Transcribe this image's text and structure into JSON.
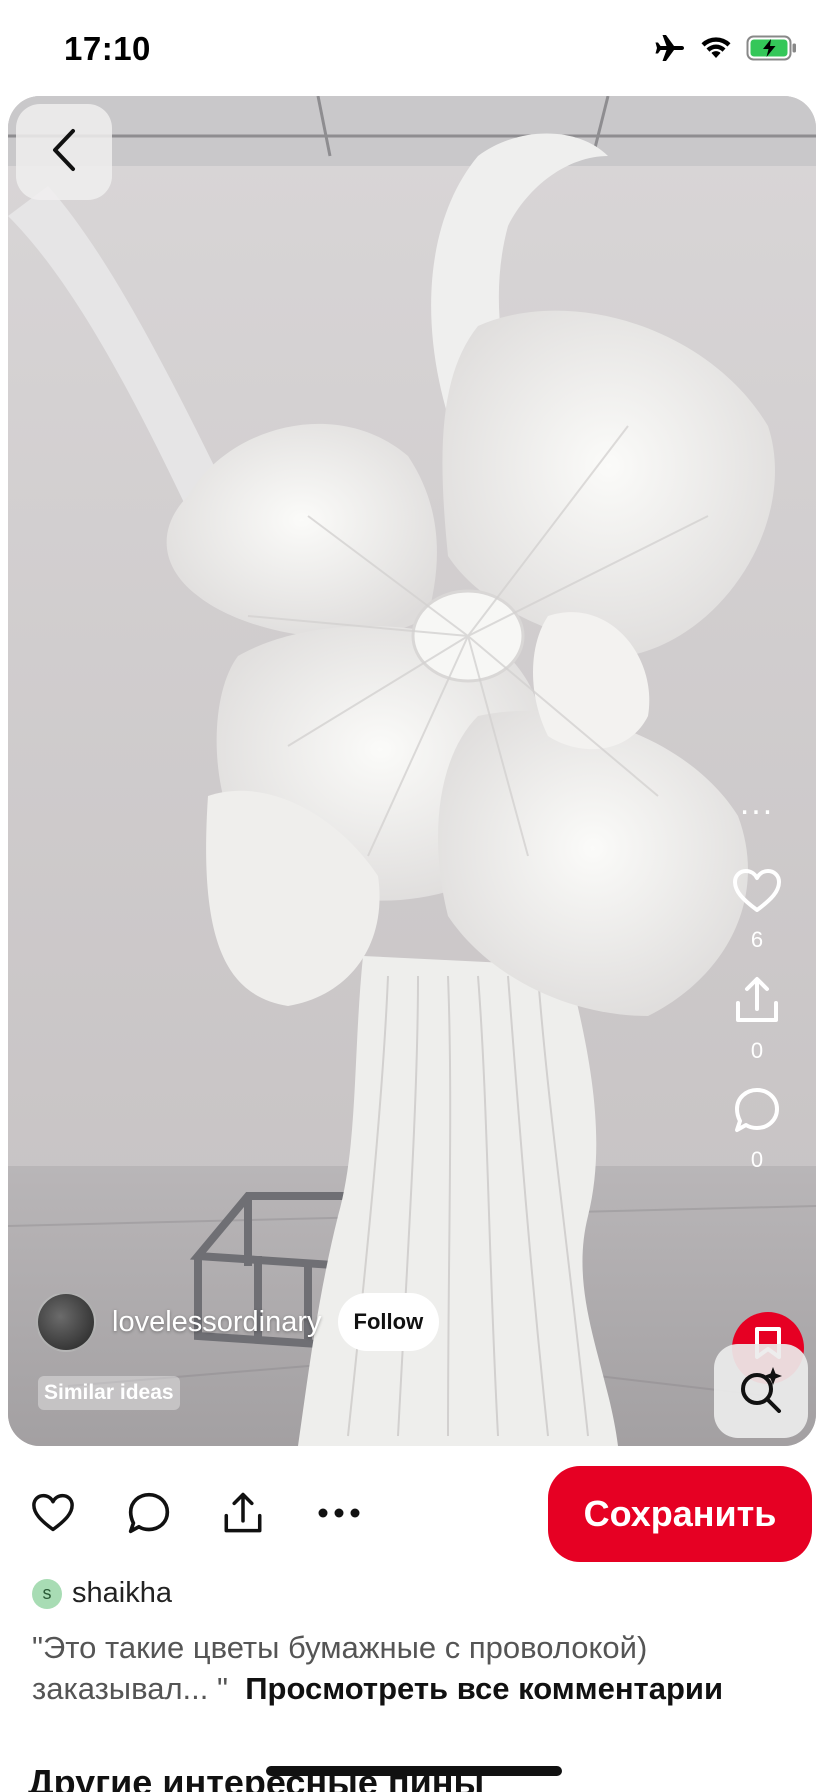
{
  "status_bar": {
    "time": "17:10",
    "icons": [
      "airplane-mode-icon",
      "wifi-icon",
      "battery-charging-icon"
    ]
  },
  "pin": {
    "image_alt": "paper flower sculpture",
    "author": {
      "name": "lovelessordinary",
      "follow_label": "Follow"
    },
    "similar_ideas_label": "Similar ideas",
    "side_actions": {
      "more_label": "...",
      "likes": "6",
      "shares": "0",
      "comments": "0"
    }
  },
  "action_bar": {
    "icons": [
      "heart-icon",
      "comment-icon",
      "share-icon",
      "more-icon"
    ],
    "save_label": "Сохранить"
  },
  "comment": {
    "avatar_letter": "s",
    "user": "shaikha",
    "text": "\"Это такие цветы бумажные с проволокой) заказывал... \"",
    "view_all_label": "Просмотреть все комментарии"
  },
  "section": {
    "heading": "Другие интересные пины"
  },
  "colors": {
    "brand_red": "#e60023",
    "battery_green": "#34c759"
  }
}
